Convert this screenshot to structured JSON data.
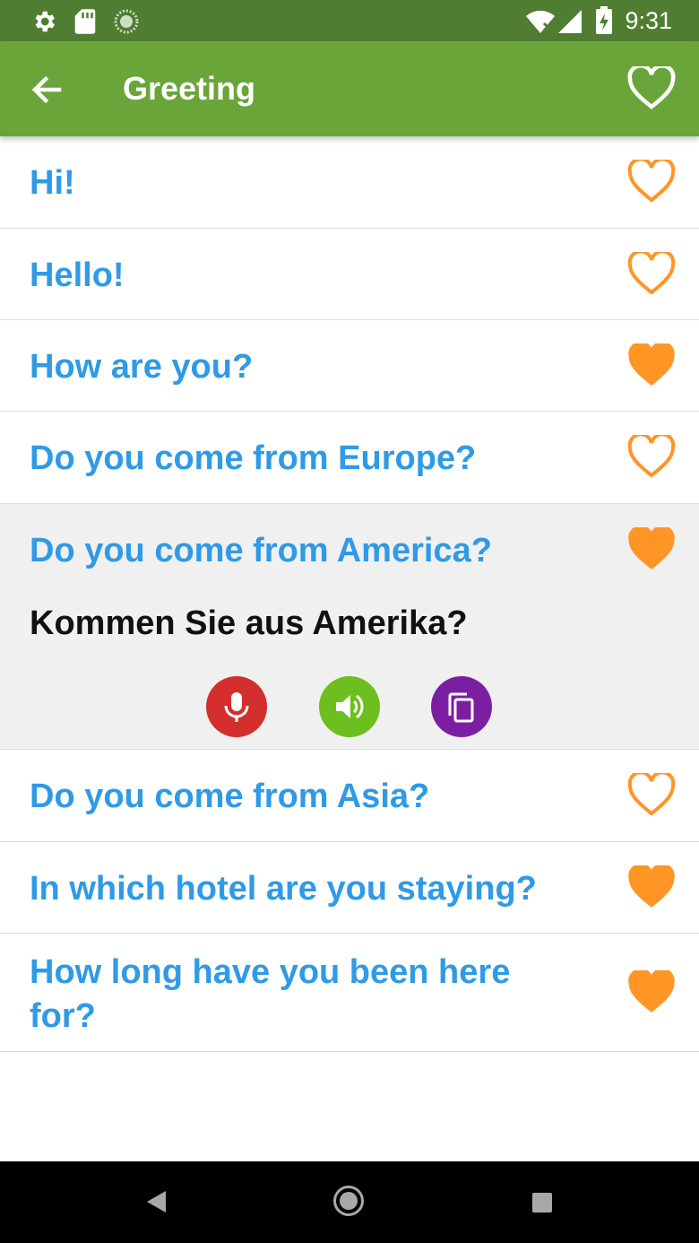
{
  "status_bar": {
    "time": "9:31",
    "left_icons": [
      "gear-icon",
      "sd-card-icon",
      "sync-icon"
    ],
    "right_icons": [
      "wifi-icon",
      "signal-icon",
      "battery-charging-icon"
    ]
  },
  "app_bar": {
    "title": "Greeting",
    "back_icon": "arrow-left-icon",
    "favorite_icon": "heart-outline-icon"
  },
  "phrases": [
    {
      "text": "Hi!",
      "favorite": false
    },
    {
      "text": "Hello!",
      "favorite": false
    },
    {
      "text": "How are you?",
      "favorite": true
    },
    {
      "text": "Do you come from Europe?",
      "favorite": false
    },
    {
      "text": "Do you come from America?",
      "favorite": true,
      "expanded": true,
      "translation": "Kommen Sie aus Amerika?"
    },
    {
      "text": "Do you come from Asia?",
      "favorite": false
    },
    {
      "text": "In which hotel are you staying?",
      "favorite": true
    },
    {
      "text_line1": "How long have you been here",
      "text_line2": "for?",
      "favorite": true
    }
  ],
  "actions": [
    {
      "name": "record",
      "icon": "microphone-icon",
      "color": "#d32f2f"
    },
    {
      "name": "play",
      "icon": "speaker-icon",
      "color": "#6cbf1f"
    },
    {
      "name": "copy",
      "icon": "copy-icon",
      "color": "#7b1fa2"
    }
  ],
  "colors": {
    "status_bar": "#4f7d32",
    "app_bar": "#6aa53a",
    "phrase_text": "#2f9ae6",
    "heart": "#ff9525",
    "expanded_bg": "#f0f0f0"
  },
  "nav_bar": {
    "icons": [
      "back-triangle-icon",
      "home-circle-icon",
      "recents-square-icon"
    ]
  }
}
